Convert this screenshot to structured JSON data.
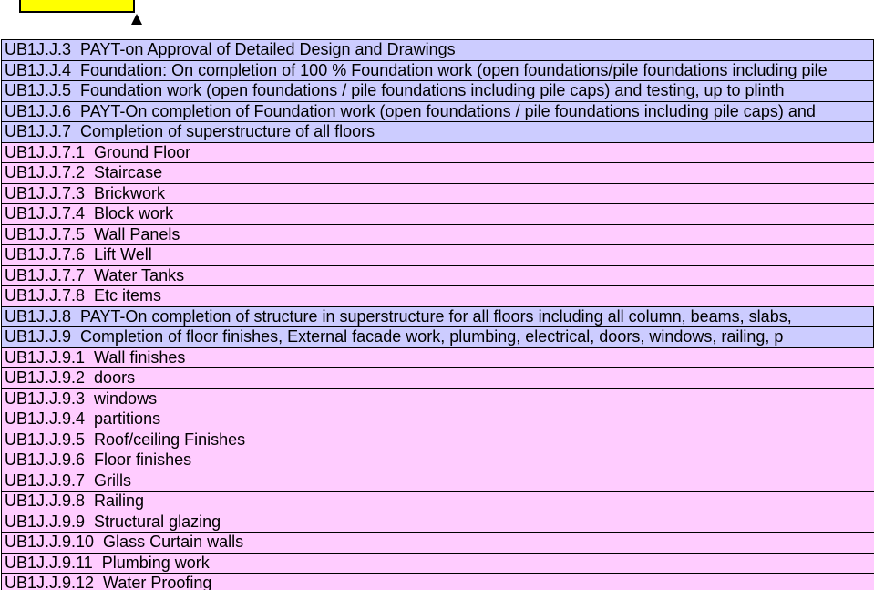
{
  "colors": {
    "header_box": "#ffff00",
    "level_row": "#ccccff",
    "sub_row": "#ffccff",
    "border": "#000000"
  },
  "rows": [
    {
      "text": "UB1J.J.3  PAYT-on Approval of Detailed Design and Drawings",
      "level": "blue"
    },
    {
      "text": "UB1J.J.4  Foundation: On completion of 100 % Foundation work (open foundations/pile foundations including pile",
      "level": "blue"
    },
    {
      "text": "UB1J.J.5  Foundation work (open foundations / pile foundations including pile caps) and testing, up to plinth",
      "level": "blue"
    },
    {
      "text": "UB1J.J.6  PAYT-On completion of Foundation work (open foundations / pile foundations including pile caps) and",
      "level": "blue"
    },
    {
      "text": "UB1J.J.7  Completion of superstructure of all floors",
      "level": "blue"
    },
    {
      "text": "UB1J.J.7.1  Ground Floor",
      "level": "pink"
    },
    {
      "text": "UB1J.J.7.2  Staircase",
      "level": "pink"
    },
    {
      "text": "UB1J.J.7.3  Brickwork",
      "level": "pink"
    },
    {
      "text": "UB1J.J.7.4  Block work",
      "level": "pink"
    },
    {
      "text": "UB1J.J.7.5  Wall Panels",
      "level": "pink"
    },
    {
      "text": "UB1J.J.7.6  Lift Well",
      "level": "pink"
    },
    {
      "text": "UB1J.J.7.7  Water Tanks",
      "level": "pink"
    },
    {
      "text": "UB1J.J.7.8  Etc items",
      "level": "pink"
    },
    {
      "text": "UB1J.J.8  PAYT-On completion of structure in superstructure for all floors including all column, beams, slabs,",
      "level": "blue"
    },
    {
      "text": "UB1J.J.9  Completion of floor finishes, External facade work, plumbing, electrical, doors, windows, railing, p",
      "level": "blue"
    },
    {
      "text": "UB1J.J.9.1  Wall finishes",
      "level": "pink"
    },
    {
      "text": "UB1J.J.9.2  doors",
      "level": "pink"
    },
    {
      "text": "UB1J.J.9.3  windows",
      "level": "pink"
    },
    {
      "text": "UB1J.J.9.4  partitions",
      "level": "pink"
    },
    {
      "text": "UB1J.J.9.5  Roof/ceiling Finishes",
      "level": "pink"
    },
    {
      "text": "UB1J.J.9.6  Floor finishes",
      "level": "pink"
    },
    {
      "text": "UB1J.J.9.7  Grills",
      "level": "pink"
    },
    {
      "text": "UB1J.J.9.8  Railing",
      "level": "pink"
    },
    {
      "text": "UB1J.J.9.9  Structural glazing",
      "level": "pink"
    },
    {
      "text": "UB1J.J.9.10  Glass Curtain walls",
      "level": "pink"
    },
    {
      "text": "UB1J.J.9.11  Plumbing work",
      "level": "pink"
    },
    {
      "text": "UB1J.J.9.12  Water Proofing",
      "level": "pink"
    }
  ]
}
